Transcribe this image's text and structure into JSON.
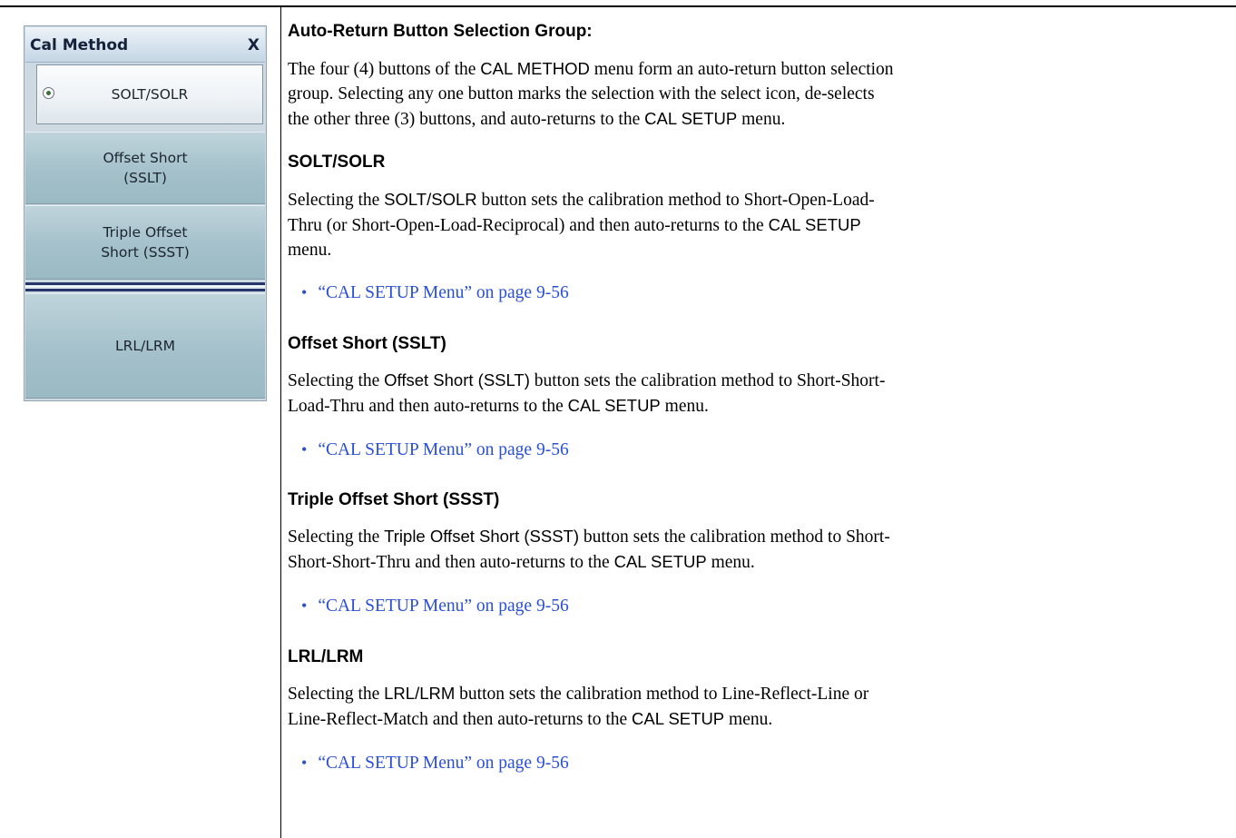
{
  "menu": {
    "title": "Cal Method",
    "close_label": "X",
    "buttons": [
      {
        "label": "SOLT/SOLR",
        "selected": true
      },
      {
        "label": "Offset Short\n(SSLT)",
        "selected": false
      },
      {
        "label": "Triple Offset\nShort (SSST)",
        "selected": false
      },
      {
        "label": "LRL/LRM",
        "selected": false
      }
    ]
  },
  "doc": {
    "intro_heading": "Auto-Return Button Selection Group:",
    "intro": {
      "l1a": "The four (4) buttons of the ",
      "l1b": "CAL METHOD",
      "l1c": " menu form an auto-return button selection",
      "l2": "group. Selecting any one button marks the selection with the select icon, de-selects",
      "l3a": "the other three (3) buttons, and auto-returns to the ",
      "l3b": "CAL SETUP",
      "l3c": " menu."
    },
    "solt": {
      "heading": "SOLT/SOLR",
      "l1a": "Selecting the ",
      "l1b": "SOLT/SOLR",
      "l1c": " button sets the calibration method to Short-Open-Load-",
      "l2a": "Thru (or Short-Open-Load-Reciprocal) and then auto-returns to the ",
      "l2b": "CAL SETUP",
      "l3": "menu.",
      "link": "“CAL SETUP Menu” on page 9-56"
    },
    "sslt": {
      "heading": "Offset Short (SSLT)",
      "l1a": "Selecting the ",
      "l1b": "Offset Short (SSLT)",
      "l1c": " button sets the calibration method to Short-Short-",
      "l2a": "Load-Thru and then auto-returns to the ",
      "l2b": "CAL SETUP",
      "l2c": " menu.",
      "link": "“CAL SETUP Menu” on page 9-56"
    },
    "ssst": {
      "heading": "Triple Offset Short (SSST)",
      "l1a": "Selecting the ",
      "l1b": "Triple Offset Short (SSST)",
      "l1c": " button sets the calibration method to Short-",
      "l2a": "Short-Short-Thru and then auto-returns to the ",
      "l2b": "CAL SETUP",
      "l2c": " menu.",
      "link": "“CAL SETUP Menu” on page 9-56"
    },
    "lrl": {
      "heading": "LRL/LRM",
      "l1a": "Selecting the ",
      "l1b": "LRL/LRM",
      "l1c": " button sets the calibration method to Line-Reflect-Line or",
      "l2a": "Line-Reflect-Match and then auto-returns to the ",
      "l2b": "CAL SETUP",
      "l2c": " menu.",
      "link": "“CAL SETUP Menu” on page 9-56"
    },
    "bullet": "•"
  }
}
